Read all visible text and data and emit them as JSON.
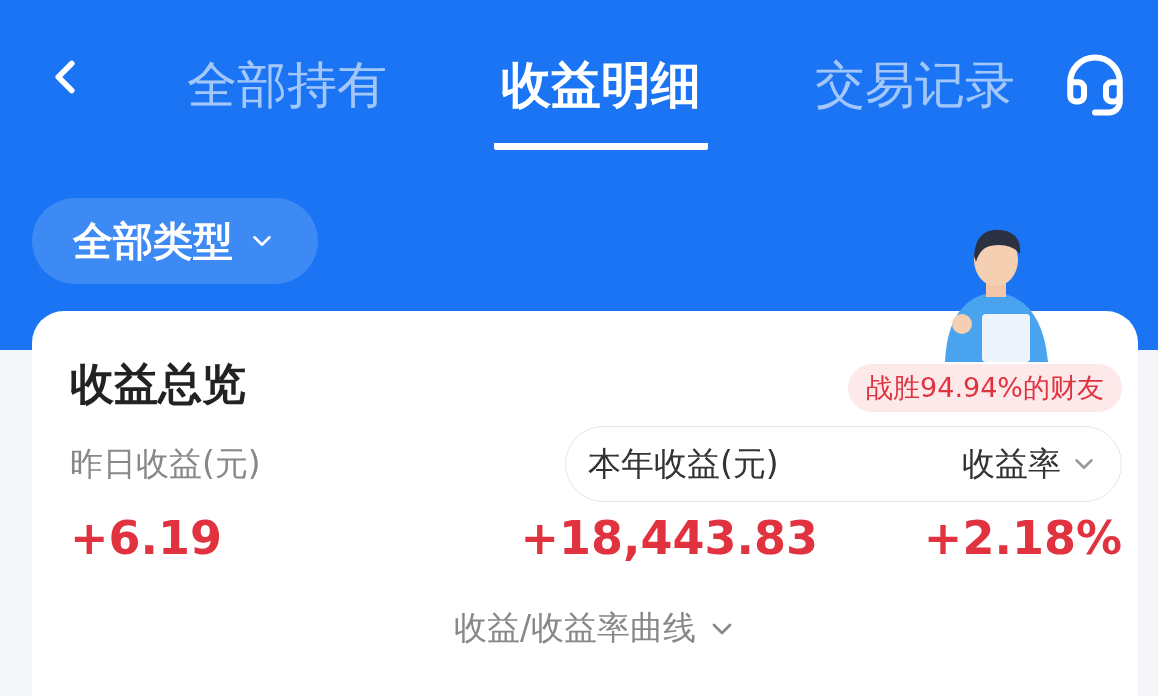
{
  "header": {
    "tabs": [
      {
        "label": "全部持有",
        "selected": false
      },
      {
        "label": "收益明细",
        "selected": true
      },
      {
        "label": "交易记录",
        "selected": false
      }
    ]
  },
  "filter": {
    "label": "全部类型"
  },
  "overview": {
    "title": "收益总览",
    "badge": "战胜94.94%的财友",
    "yesterday": {
      "label": "昨日收益(元)",
      "value": "+6.19"
    },
    "year": {
      "label": "本年收益(元)",
      "value": "+18,443.83"
    },
    "rate": {
      "label": "收益率",
      "value": "+2.18%"
    },
    "curve_link": "收益/收益率曲线"
  }
}
